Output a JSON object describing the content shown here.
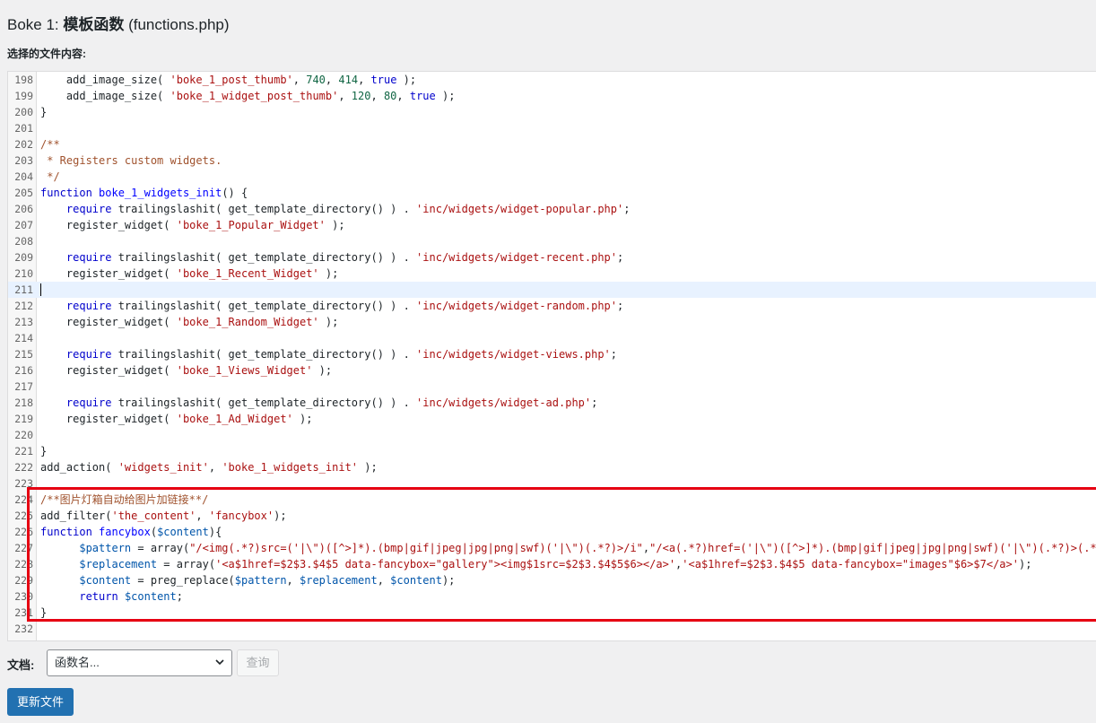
{
  "header": {
    "title_prefix": "Boke 1: ",
    "title_bold": "模板函数",
    "title_suffix": " (functions.php)",
    "file_content_label": "选择的文件内容:"
  },
  "editor": {
    "active_line": 211,
    "lines": [
      {
        "n": 198,
        "tokens": [
          [
            "",
            "    add_image_size( "
          ],
          [
            "str",
            "'boke_1_post_thumb'"
          ],
          [
            "",
            ", "
          ],
          [
            "num",
            "740"
          ],
          [
            "",
            ", "
          ],
          [
            "num",
            "414"
          ],
          [
            "",
            ", "
          ],
          [
            "kw",
            "true"
          ],
          [
            "",
            " );"
          ]
        ]
      },
      {
        "n": 199,
        "tokens": [
          [
            "",
            "    add_image_size( "
          ],
          [
            "str",
            "'boke_1_widget_post_thumb'"
          ],
          [
            "",
            ", "
          ],
          [
            "num",
            "120"
          ],
          [
            "",
            ", "
          ],
          [
            "num",
            "80"
          ],
          [
            "",
            ", "
          ],
          [
            "kw",
            "true"
          ],
          [
            "",
            " );"
          ]
        ]
      },
      {
        "n": 200,
        "tokens": [
          [
            "",
            "}"
          ]
        ]
      },
      {
        "n": 201,
        "tokens": []
      },
      {
        "n": 202,
        "tokens": [
          [
            "cm",
            "/**"
          ]
        ]
      },
      {
        "n": 203,
        "tokens": [
          [
            "cm",
            " * Registers custom widgets."
          ]
        ]
      },
      {
        "n": 204,
        "tokens": [
          [
            "cm",
            " */"
          ]
        ]
      },
      {
        "n": 205,
        "tokens": [
          [
            "kw",
            "function"
          ],
          [
            "",
            " "
          ],
          [
            "def",
            "boke_1_widgets_init"
          ],
          [
            "",
            "() {"
          ]
        ]
      },
      {
        "n": 206,
        "tokens": [
          [
            "",
            "    "
          ],
          [
            "kw",
            "require"
          ],
          [
            "",
            " trailingslashit( get_template_directory() ) . "
          ],
          [
            "str",
            "'inc/widgets/widget-popular.php'"
          ],
          [
            "",
            ";"
          ]
        ]
      },
      {
        "n": 207,
        "tokens": [
          [
            "",
            "    register_widget( "
          ],
          [
            "str",
            "'boke_1_Popular_Widget'"
          ],
          [
            "",
            " );"
          ]
        ]
      },
      {
        "n": 208,
        "tokens": []
      },
      {
        "n": 209,
        "tokens": [
          [
            "",
            "    "
          ],
          [
            "kw",
            "require"
          ],
          [
            "",
            " trailingslashit( get_template_directory() ) . "
          ],
          [
            "str",
            "'inc/widgets/widget-recent.php'"
          ],
          [
            "",
            ";"
          ]
        ]
      },
      {
        "n": 210,
        "tokens": [
          [
            "",
            "    register_widget( "
          ],
          [
            "str",
            "'boke_1_Recent_Widget'"
          ],
          [
            "",
            " );"
          ]
        ]
      },
      {
        "n": 211,
        "tokens": []
      },
      {
        "n": 212,
        "tokens": [
          [
            "",
            "    "
          ],
          [
            "kw",
            "require"
          ],
          [
            "",
            " trailingslashit( get_template_directory() ) . "
          ],
          [
            "str",
            "'inc/widgets/widget-random.php'"
          ],
          [
            "",
            ";"
          ]
        ]
      },
      {
        "n": 213,
        "tokens": [
          [
            "",
            "    register_widget( "
          ],
          [
            "str",
            "'boke_1_Random_Widget'"
          ],
          [
            "",
            " );"
          ]
        ]
      },
      {
        "n": 214,
        "tokens": []
      },
      {
        "n": 215,
        "tokens": [
          [
            "",
            "    "
          ],
          [
            "kw",
            "require"
          ],
          [
            "",
            " trailingslashit( get_template_directory() ) . "
          ],
          [
            "str",
            "'inc/widgets/widget-views.php'"
          ],
          [
            "",
            ";"
          ]
        ]
      },
      {
        "n": 216,
        "tokens": [
          [
            "",
            "    register_widget( "
          ],
          [
            "str",
            "'boke_1_Views_Widget'"
          ],
          [
            "",
            " );"
          ]
        ]
      },
      {
        "n": 217,
        "tokens": []
      },
      {
        "n": 218,
        "tokens": [
          [
            "",
            "    "
          ],
          [
            "kw",
            "require"
          ],
          [
            "",
            " trailingslashit( get_template_directory() ) . "
          ],
          [
            "str",
            "'inc/widgets/widget-ad.php'"
          ],
          [
            "",
            ";"
          ]
        ]
      },
      {
        "n": 219,
        "tokens": [
          [
            "",
            "    register_widget( "
          ],
          [
            "str",
            "'boke_1_Ad_Widget'"
          ],
          [
            "",
            " );"
          ]
        ]
      },
      {
        "n": 220,
        "tokens": []
      },
      {
        "n": 221,
        "tokens": [
          [
            "",
            "}"
          ]
        ]
      },
      {
        "n": 222,
        "tokens": [
          [
            "",
            "add_action( "
          ],
          [
            "str",
            "'widgets_init'"
          ],
          [
            "",
            ", "
          ],
          [
            "str",
            "'boke_1_widgets_init'"
          ],
          [
            "",
            " );"
          ]
        ]
      },
      {
        "n": 223,
        "tokens": []
      },
      {
        "n": 224,
        "tokens": [
          [
            "cm",
            "/**图片灯箱自动给图片加链接**/"
          ]
        ]
      },
      {
        "n": 225,
        "tokens": [
          [
            "",
            "add_filter("
          ],
          [
            "str",
            "'the_content'"
          ],
          [
            "",
            ", "
          ],
          [
            "str",
            "'fancybox'"
          ],
          [
            "",
            ");"
          ]
        ]
      },
      {
        "n": 226,
        "tokens": [
          [
            "kw",
            "function"
          ],
          [
            "",
            " "
          ],
          [
            "def",
            "fancybox"
          ],
          [
            "",
            "("
          ],
          [
            "var",
            "$content"
          ],
          [
            "",
            "){"
          ]
        ]
      },
      {
        "n": 227,
        "tokens": [
          [
            "",
            "      "
          ],
          [
            "var",
            "$pattern"
          ],
          [
            "",
            " = array("
          ],
          [
            "str",
            "\"/<img(.*?)src=('|\\\")([^>]*).(bmp|gif|jpeg|jpg|png|swf)('|\\\")(.*?)>/i\""
          ],
          [
            "",
            ","
          ],
          [
            "str",
            "\"/<a(.*?)href=('|\\\")([^>]*).(bmp|gif|jpeg|jpg|png|swf)('|\\\")(.*?)>(.*?)<\\/a>/i\""
          ],
          [
            "",
            ");"
          ]
        ]
      },
      {
        "n": 228,
        "tokens": [
          [
            "",
            "      "
          ],
          [
            "var",
            "$replacement"
          ],
          [
            "",
            " = array("
          ],
          [
            "str",
            "'<a$1href=$2$3.$4$5 data-fancybox=\"gallery\"><img$1src=$2$3.$4$5$6></a>'"
          ],
          [
            "",
            ","
          ],
          [
            "str",
            "'<a$1href=$2$3.$4$5 data-fancybox=\"images\"$6>$7</a>'"
          ],
          [
            "",
            ");"
          ]
        ]
      },
      {
        "n": 229,
        "tokens": [
          [
            "",
            "      "
          ],
          [
            "var",
            "$content"
          ],
          [
            "",
            " = preg_replace("
          ],
          [
            "var",
            "$pattern"
          ],
          [
            "",
            ", "
          ],
          [
            "var",
            "$replacement"
          ],
          [
            "",
            ", "
          ],
          [
            "var",
            "$content"
          ],
          [
            "",
            ");"
          ]
        ]
      },
      {
        "n": 230,
        "tokens": [
          [
            "",
            "      "
          ],
          [
            "kw",
            "return"
          ],
          [
            "",
            " "
          ],
          [
            "var",
            "$content"
          ],
          [
            "",
            ";"
          ]
        ]
      },
      {
        "n": 231,
        "tokens": [
          [
            "",
            "}"
          ]
        ]
      },
      {
        "n": 232,
        "tokens": []
      }
    ]
  },
  "footer": {
    "doc_label": "文档:",
    "doc_select_value": "函数名...",
    "lookup_label": "查询",
    "update_label": "更新文件"
  },
  "colors": {
    "accent": "#2271b1",
    "highlight_box": "#e60012",
    "active_line": "#e8f2ff"
  },
  "icons": {
    "select_chevron": "chevron-down-icon"
  }
}
